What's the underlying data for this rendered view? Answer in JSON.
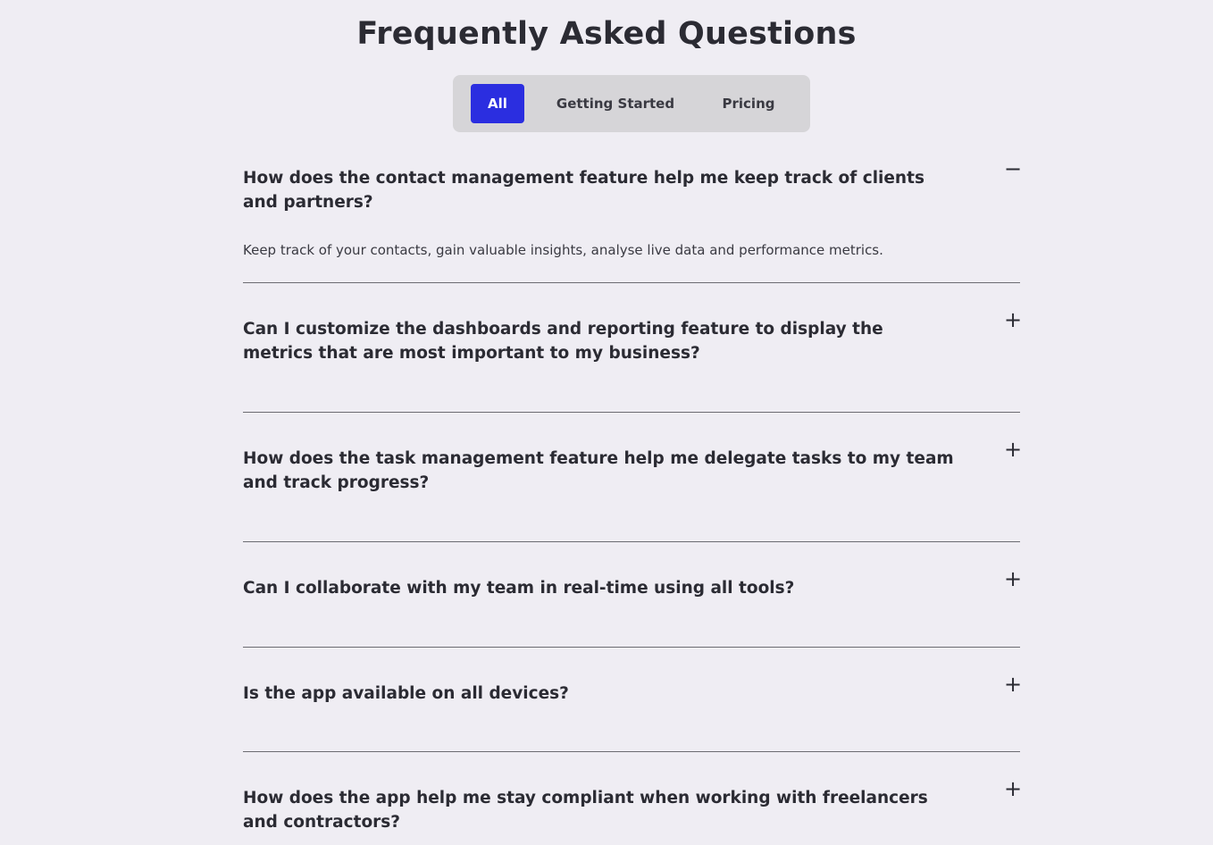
{
  "title": "Frequently Asked Questions",
  "tabs": [
    {
      "label": "All",
      "active": true
    },
    {
      "label": "Getting Started",
      "active": false
    },
    {
      "label": "Pricing",
      "active": false
    }
  ],
  "faqs": [
    {
      "question": "How does the contact management feature help me keep track of clients and partners?",
      "answer": "Keep track of your contacts, gain valuable insights, analyse live data and performance metrics.",
      "expanded": true,
      "toggle": "−"
    },
    {
      "question": "Can I customize the dashboards and reporting feature to display the metrics that are most important to my business?",
      "expanded": false,
      "toggle": "+"
    },
    {
      "question": "How does the task management feature help me delegate tasks to my team and track progress?",
      "expanded": false,
      "toggle": "+"
    },
    {
      "question": "Can I collaborate with my team in real-time using all tools?",
      "expanded": false,
      "toggle": "+"
    },
    {
      "question": "Is the app available on all devices?",
      "expanded": false,
      "toggle": "+"
    },
    {
      "question": "How does the app help me stay compliant when working with freelancers and contractors?",
      "expanded": false,
      "toggle": "+"
    }
  ],
  "colors": {
    "background": "#efedf3",
    "accent": "#2b2ee0",
    "tab_bar": "#d6d5d8",
    "text": "#2b2b33",
    "divider": "#6c6c72"
  },
  "icons": {
    "expanded": "minus-icon",
    "collapsed": "plus-icon"
  }
}
